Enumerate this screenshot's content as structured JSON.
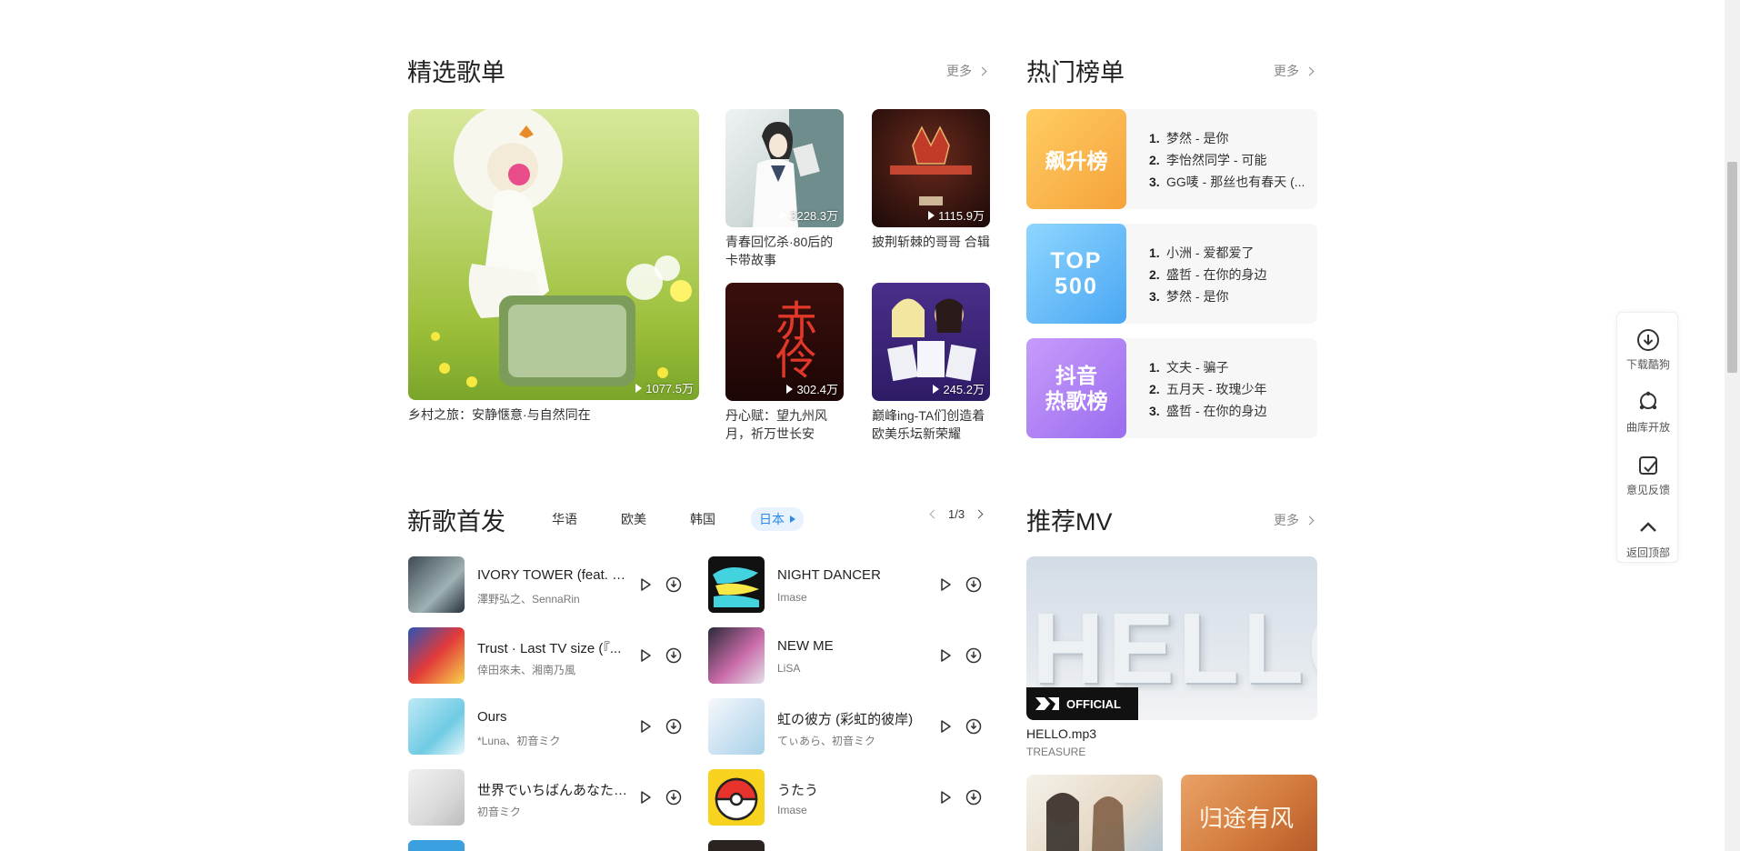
{
  "playlists": {
    "title": "精选歌单",
    "more": "更多",
    "items": [
      {
        "name": "乡村之旅：安静惬意·与自然同在",
        "plays": "1077.5万"
      },
      {
        "name": "青春回忆杀·80后的卡带故事",
        "plays": "3228.3万"
      },
      {
        "name": "披荆斩棘的哥哥 合辑",
        "plays": "1115.9万"
      },
      {
        "name": "丹心赋：望九州风月，祈万世长安",
        "plays": "302.4万"
      },
      {
        "name": "巅峰ing-TA们创造着欧美乐坛新荣耀",
        "plays": "245.2万"
      }
    ],
    "cover_texts": {
      "chiling": "赤伶"
    }
  },
  "ranks": {
    "title": "热门榜单",
    "more": "更多",
    "items": [
      {
        "cover": "飙升榜",
        "songs": [
          "梦然 - 是你",
          "李怡然同学 - 可能",
          "GG唛 - 那丝也有春天 (..."
        ]
      },
      {
        "cover": "TOP 500",
        "songs": [
          "小洲 - 爱都爱了",
          "盛哲 - 在你的身边",
          "梦然 - 是你"
        ]
      },
      {
        "cover": "抖音 热歌榜",
        "songs": [
          "文夫 - 骗子",
          "五月天 - 玫瑰少年",
          "盛哲 - 在你的身边"
        ]
      }
    ],
    "numbers": [
      "1.",
      "2.",
      "3."
    ]
  },
  "new_songs": {
    "title": "新歌首发",
    "tabs": [
      "华语",
      "欧美",
      "韩国",
      "日本"
    ],
    "active_tab": 3,
    "page": "1/3",
    "left_col": [
      {
        "title": "IVORY TOWER (feat. Se...",
        "artist": "澤野弘之、SennaRin"
      },
      {
        "title": "Trust · Last TV size (『...",
        "artist": "倖田來未、湘南乃風"
      },
      {
        "title": "Ours",
        "artist": "*Luna、初音ミク"
      },
      {
        "title": "世界でいちばんあなたが...",
        "artist": "初音ミク"
      }
    ],
    "right_col": [
      {
        "title": "NIGHT DANCER",
        "artist": "Imase"
      },
      {
        "title": "NEW ME",
        "artist": "LiSA"
      },
      {
        "title": "虹の彼方 (彩虹的彼岸)",
        "artist": "てぃあら、初音ミク"
      },
      {
        "title": "うたう",
        "artist": "Imase"
      }
    ]
  },
  "mv": {
    "title": "推荐MV",
    "more": "更多",
    "main": {
      "title": "HELLO.mp3",
      "artist": "TREASURE",
      "badge": "OFFICIAL",
      "cover_text": "HELLO"
    },
    "thumb2_text": "归途有风"
  },
  "side_tools": [
    "下载酷狗",
    "曲库开放",
    "意见反馈",
    "返回顶部"
  ]
}
